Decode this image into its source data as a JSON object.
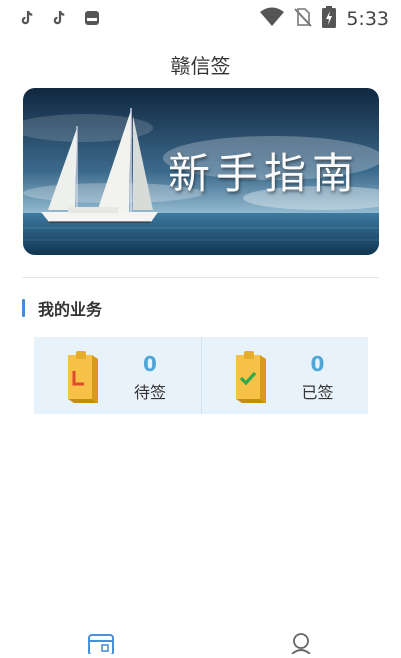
{
  "status_bar": {
    "time": "5:33",
    "left_icons": [
      "tiktok-icon",
      "tiktok-icon",
      "app-notification-icon"
    ],
    "right_icons": [
      "wifi-icon",
      "no-sim-icon",
      "battery-charging-icon"
    ]
  },
  "header": {
    "title": "赣信签"
  },
  "banner": {
    "text": "新手指南"
  },
  "section": {
    "title": "我的业务"
  },
  "cards": [
    {
      "count": "0",
      "label": "待签",
      "icon": "pending-document-icon"
    },
    {
      "count": "0",
      "label": "已签",
      "icon": "signed-document-icon"
    }
  ],
  "nav": {
    "items": [
      {
        "icon": "documents-icon"
      },
      {
        "icon": "user-icon"
      }
    ]
  },
  "colors": {
    "accent": "#3f8fe0",
    "count": "#4ea7d6",
    "card_bg": "#e8f2fb"
  }
}
